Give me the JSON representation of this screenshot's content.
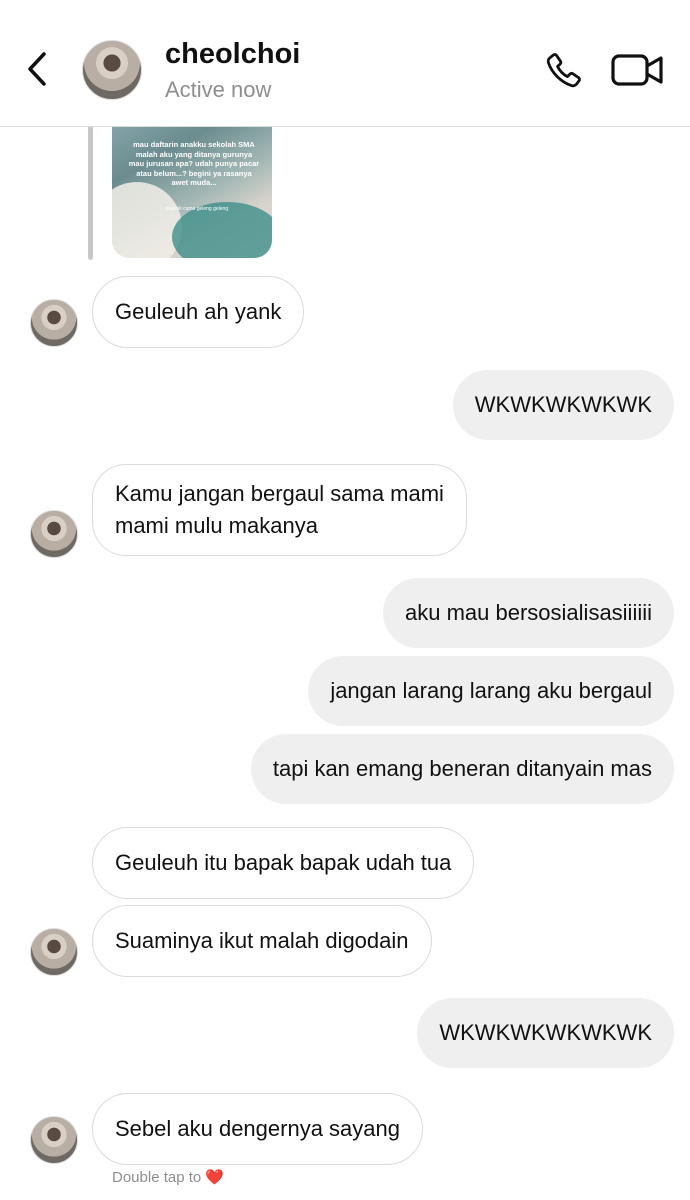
{
  "header": {
    "username": "cheolchoi",
    "status": "Active now"
  },
  "media": {
    "text": "mau daftarin anakku sekolah SMA malah aku yang ditanya gurunya mau jurusan apa? udah punya pacar atau belum...? begini ya rasanya awet muda...",
    "caption": "suamik cuma geleng geleng"
  },
  "messages": [
    {
      "text": "Geuleuh ah yank"
    },
    {
      "text": "WKWKWKWKWK"
    },
    {
      "line1": "Kamu jangan bergaul sama mami",
      "line2": "mami mulu makanya"
    },
    {
      "text": "aku mau bersosialisasiiiiii"
    },
    {
      "text": "jangan larang larang aku bergaul"
    },
    {
      "text": "tapi kan emang beneran ditanyain mas"
    },
    {
      "text": "Geuleuh itu bapak bapak udah tua"
    },
    {
      "text": "Suaminya ikut malah digodain"
    },
    {
      "text": "WKWKWKWKWKWK"
    },
    {
      "text": "Sebel aku dengernya sayang"
    }
  ],
  "footer": {
    "double_tap": "Double tap to",
    "heart": "❤️"
  },
  "icons": {
    "back": "chevron-left-icon",
    "call": "phone-icon",
    "video": "video-camera-icon"
  }
}
